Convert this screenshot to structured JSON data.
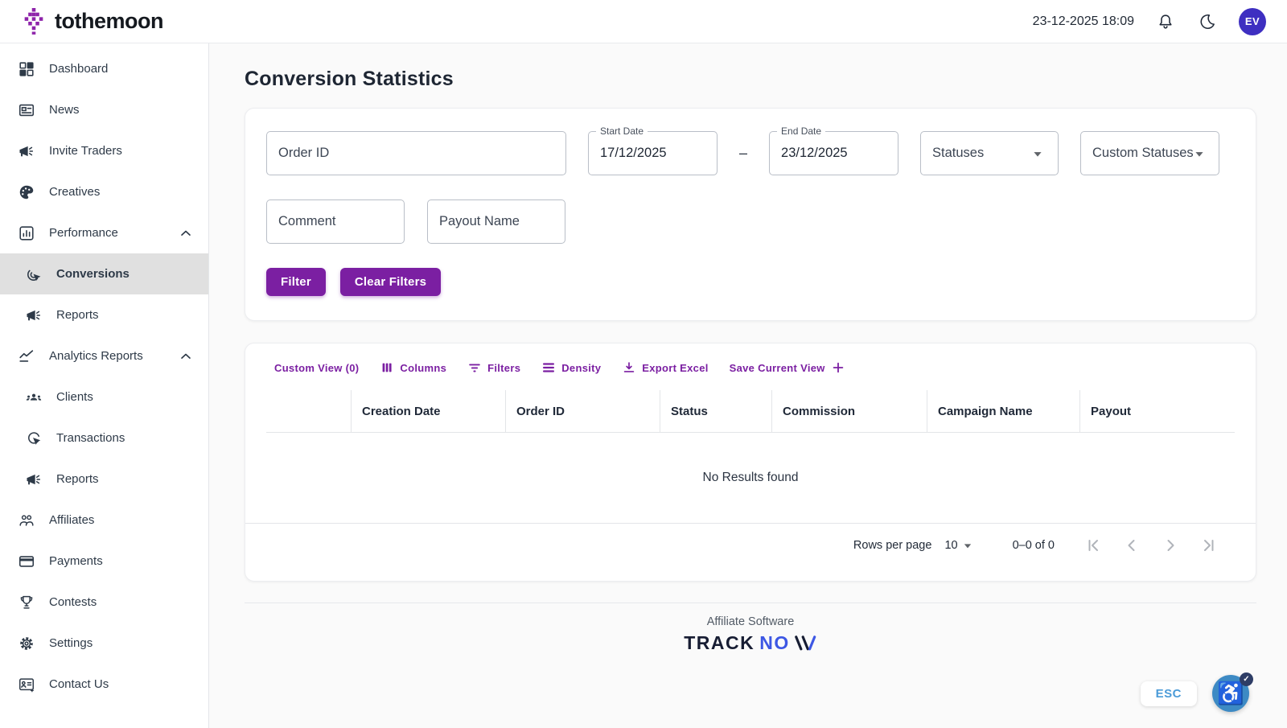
{
  "header": {
    "brand": "tothemoon",
    "datetime": "23-12-2025 18:09",
    "avatar_initials": "EV"
  },
  "sidebar": {
    "items": [
      {
        "label": "Dashboard",
        "icon": "dashboard-icon"
      },
      {
        "label": "News",
        "icon": "news-icon"
      },
      {
        "label": "Invite Traders",
        "icon": "megaphone-icon"
      },
      {
        "label": "Creatives",
        "icon": "palette-icon"
      },
      {
        "label": "Performance",
        "icon": "bar-chart-icon",
        "expanded": true
      },
      {
        "label": "Conversions",
        "icon": "conversions-click-icon",
        "sub": true,
        "selected": true
      },
      {
        "label": "Reports",
        "icon": "megaphone-icon",
        "sub": true
      },
      {
        "label": "Analytics Reports",
        "icon": "line-chart-icon",
        "expanded": true
      },
      {
        "label": "Clients",
        "icon": "people-icon",
        "sub": true
      },
      {
        "label": "Transactions",
        "icon": "click-circle-icon",
        "sub": true
      },
      {
        "label": "Reports",
        "icon": "megaphone-icon",
        "sub": true
      },
      {
        "label": "Affiliates",
        "icon": "group-icon"
      },
      {
        "label": "Payments",
        "icon": "credit-card-icon"
      },
      {
        "label": "Contests",
        "icon": "trophy-icon"
      },
      {
        "label": "Settings",
        "icon": "gear-icon"
      },
      {
        "label": "Contact Us",
        "icon": "contact-card-icon"
      }
    ]
  },
  "page": {
    "title": "Conversion Statistics"
  },
  "filters": {
    "order_id": {
      "label": "Order ID",
      "value": ""
    },
    "start_date": {
      "label": "Start Date",
      "value": "17/12/2025"
    },
    "date_separator": "–",
    "end_date": {
      "label": "End Date",
      "value": "23/12/2025"
    },
    "statuses": {
      "label": "Statuses"
    },
    "custom_statuses": {
      "label": "Custom Statuses"
    },
    "comment": {
      "label": "Comment",
      "value": ""
    },
    "payout_name": {
      "label": "Payout Name",
      "value": ""
    },
    "filter_button": "Filter",
    "clear_button": "Clear Filters"
  },
  "table": {
    "toolbar": {
      "custom_view": "Custom View (0)",
      "columns": "Columns",
      "filters": "Filters",
      "density": "Density",
      "export_excel": "Export Excel",
      "save_view": "Save Current View"
    },
    "columns": [
      "Creation Date",
      "Order ID",
      "Status",
      "Commission",
      "Campaign Name",
      "Payout"
    ],
    "empty_message": "No Results found",
    "pagination": {
      "rows_per_page_label": "Rows per page",
      "rows_per_page_value": "10",
      "range": "0–0 of 0"
    }
  },
  "footer": {
    "tagline": "Affiliate Software",
    "brand_track": "TRACK",
    "brand_no": "NO"
  },
  "widgets": {
    "esc_label": "ESC",
    "accessibility_glyph": "♿",
    "badge_check": "✓"
  },
  "colors": {
    "accent_purple": "#7b1fa2",
    "avatar_indigo": "#3e2fc1",
    "brand_logo_purple": "#8e24aa",
    "footer_brand_navy": "#171d33",
    "footer_brand_blue": "#3d57e4",
    "accessibility_blue": "#3d8ac4",
    "selected_item_gray": "#e0e0e0"
  }
}
